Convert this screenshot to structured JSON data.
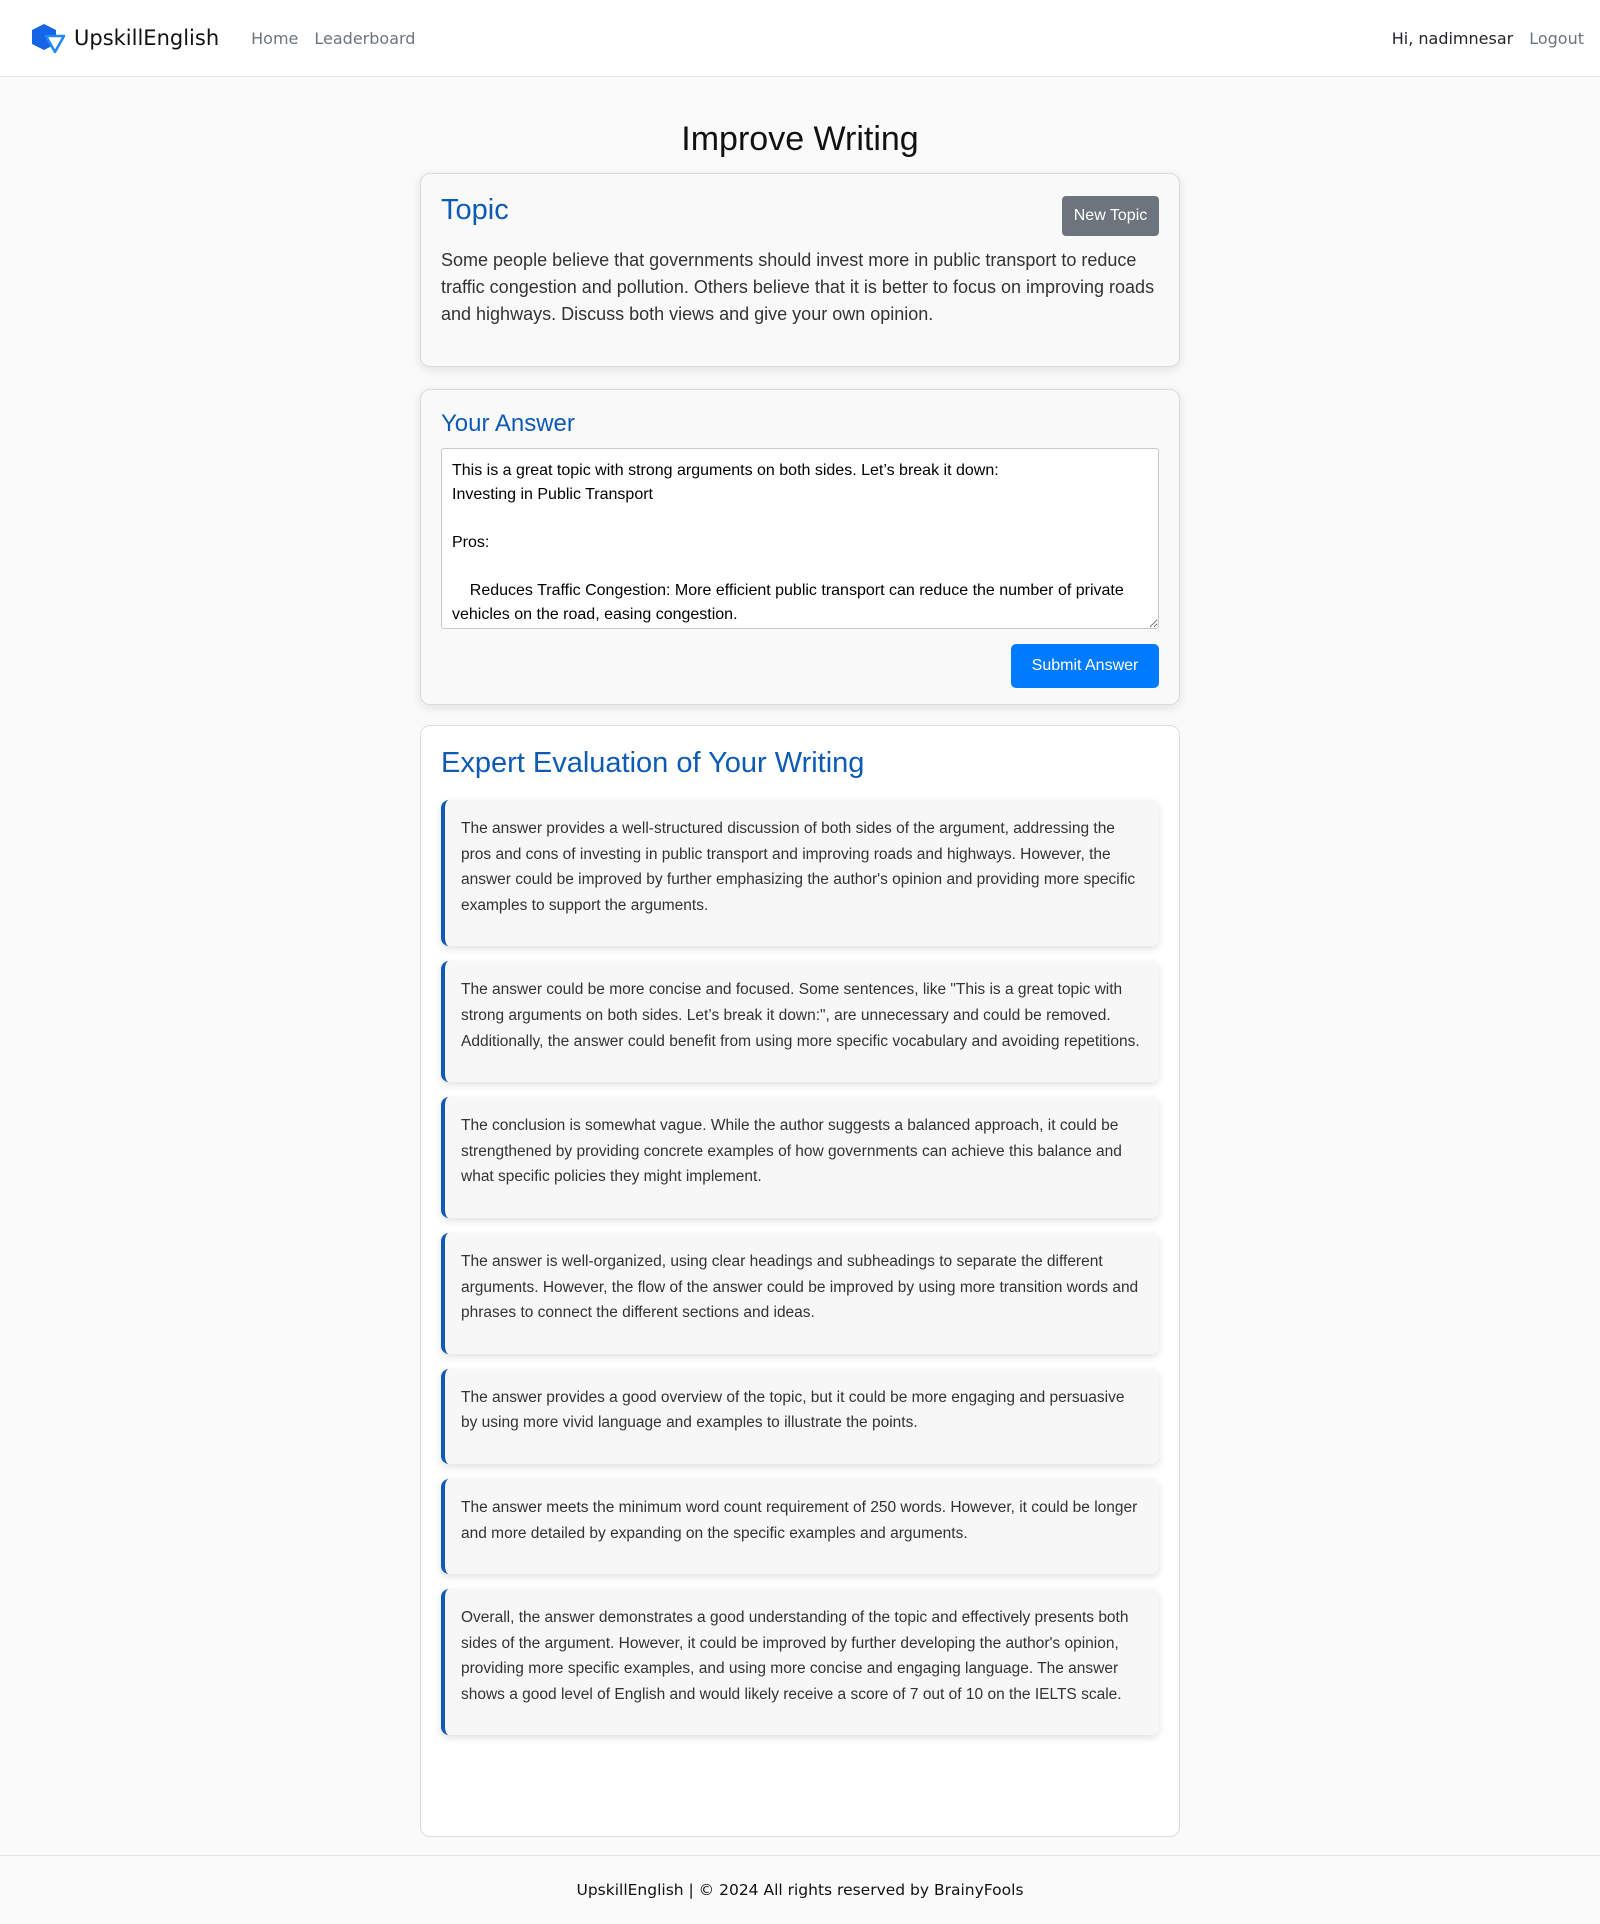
{
  "header": {
    "brand": "UpskillEnglish",
    "nav": [
      {
        "label": "Home"
      },
      {
        "label": "Leaderboard"
      }
    ],
    "greeting": "Hi, nadimnesar",
    "logout": "Logout"
  },
  "page": {
    "title": "Improve Writing"
  },
  "topic": {
    "title": "Topic",
    "new_topic_label": "New Topic",
    "text": "Some people believe that governments should invest more in public transport to reduce traffic congestion and pollution. Others believe that it is better to focus on improving roads and highways. Discuss both views and give your own opinion."
  },
  "answer": {
    "title": "Your Answer",
    "value": "This is a great topic with strong arguments on both sides. Let’s break it down:\nInvesting in Public Transport\n\nPros:\n\n    Reduces Traffic Congestion: More efficient public transport can reduce the number of private vehicles on the road, easing congestion.",
    "submit_label": "Submit Answer"
  },
  "evaluation": {
    "title": "Expert Evaluation of Your Writing",
    "items": [
      {
        "text": "The answer provides a well-structured discussion of both sides of the argument, addressing the pros and cons of investing in public transport and improving roads and highways. However, the answer could be improved by further emphasizing the author's opinion and providing more specific examples to support the arguments."
      },
      {
        "text": "The answer could be more concise and focused. Some sentences, like \"This is a great topic with strong arguments on both sides. Let’s break it down:\", are unnecessary and could be removed. Additionally, the answer could benefit from using more specific vocabulary and avoiding repetitions."
      },
      {
        "text": "The conclusion is somewhat vague. While the author suggests a balanced approach, it could be strengthened by providing concrete examples of how governments can achieve this balance and what specific policies they might implement."
      },
      {
        "text": "The answer is well-organized, using clear headings and subheadings to separate the different arguments. However, the flow of the answer could be improved by using more transition words and phrases to connect the different sections and ideas."
      },
      {
        "text": "The answer provides a good overview of the topic, but it could be more engaging and persuasive by using more vivid language and examples to illustrate the points."
      },
      {
        "text": "The answer meets the minimum word count requirement of 250 words. However, it could be longer and more detailed by expanding on the specific examples and arguments."
      },
      {
        "text": "Overall, the answer demonstrates a good understanding of the topic and effectively presents both sides of the argument. However, it could be improved by further developing the author's opinion, providing more specific examples, and using more concise and engaging language. The answer shows a good level of English and would likely receive a score of 7 out of 10 on the IELTS scale."
      }
    ]
  },
  "footer": {
    "text": "UpskillEnglish | © 2024 All rights reserved by BrainyFools"
  },
  "colors": {
    "primary": "#007bff",
    "accent_blue": "#0d5bb5",
    "secondary": "#6c757d"
  }
}
